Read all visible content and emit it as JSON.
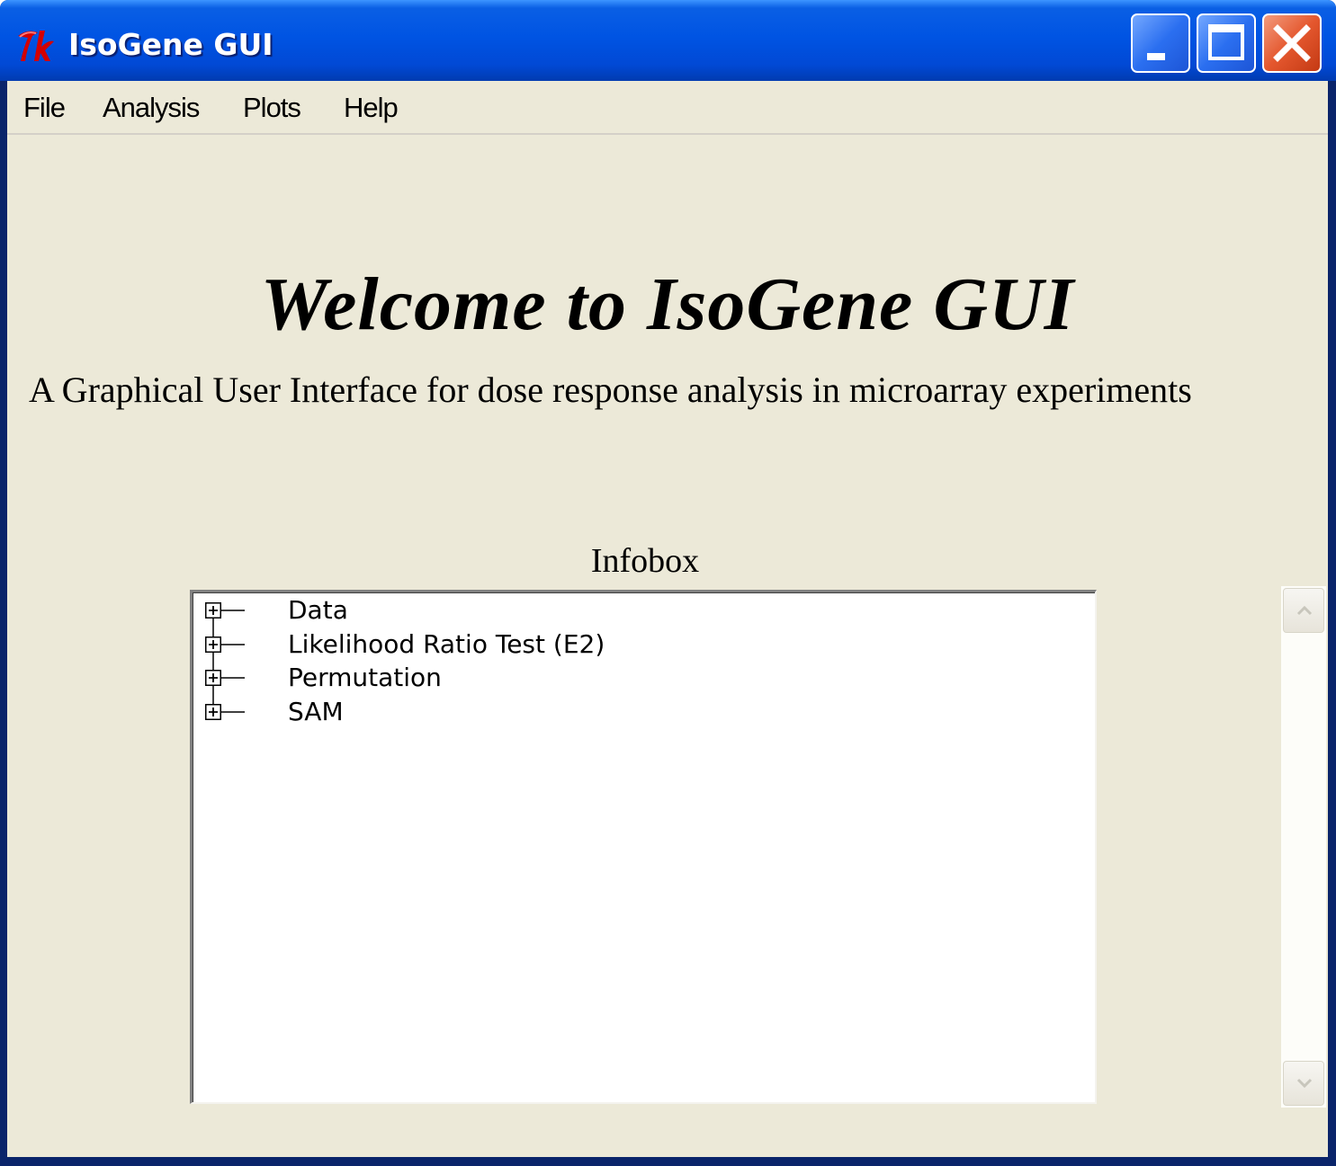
{
  "window": {
    "title": "IsoGene GUI",
    "app_icon": "tk-feather-icon",
    "controls": [
      "minimize-icon",
      "maximize-icon",
      "close-icon"
    ]
  },
  "menubar": {
    "items": [
      {
        "label": "File"
      },
      {
        "label": "Analysis"
      },
      {
        "label": "Plots"
      },
      {
        "label": "Help"
      }
    ]
  },
  "main": {
    "welcome": "Welcome to IsoGene GUI",
    "subtitle": "A Graphical User Interface for dose response analysis in microarray experiments",
    "infobox_label": "Infobox"
  },
  "infobox": {
    "items": [
      {
        "label": "Data",
        "expander": "plus-icon"
      },
      {
        "label": "Likelihood Ratio Test (E2)",
        "expander": "plus-icon"
      },
      {
        "label": "Permutation",
        "expander": "plus-icon"
      },
      {
        "label": "SAM",
        "expander": "plus-icon"
      }
    ]
  },
  "colors": {
    "titlebar": "#0054e3",
    "client_bg": "#ece9d8",
    "close_button": "#e4572e"
  }
}
